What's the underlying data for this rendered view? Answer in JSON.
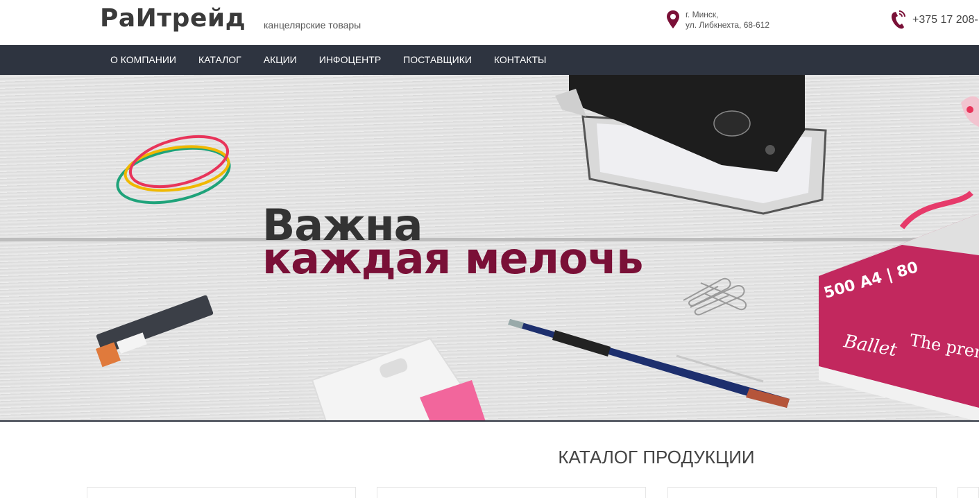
{
  "header": {
    "logo": "РаИтрейд",
    "tagline": "канцелярские товары",
    "address_line1": "г. Минск,",
    "address_line2": "ул. Либкнехта, 68-612",
    "phone": "+375 17 208-",
    "address_icon": "map-pin-icon",
    "phone_icon": "phone-icon"
  },
  "nav": {
    "items": [
      "О КОМПАНИИ",
      "КАТАЛОГ",
      "АКЦИИ",
      "ИНФОЦЕНТР",
      "ПОСТАВЩИКИ",
      "КОНТАКТЫ"
    ]
  },
  "hero": {
    "line1": "Важна",
    "line2": "каждая мелочь"
  },
  "catalog": {
    "title": "КАТАЛОГ ПРОДУКЦИИ"
  },
  "colors": {
    "nav_bg": "#2e3440",
    "accent": "#7a1037",
    "text_dark": "#333333"
  }
}
